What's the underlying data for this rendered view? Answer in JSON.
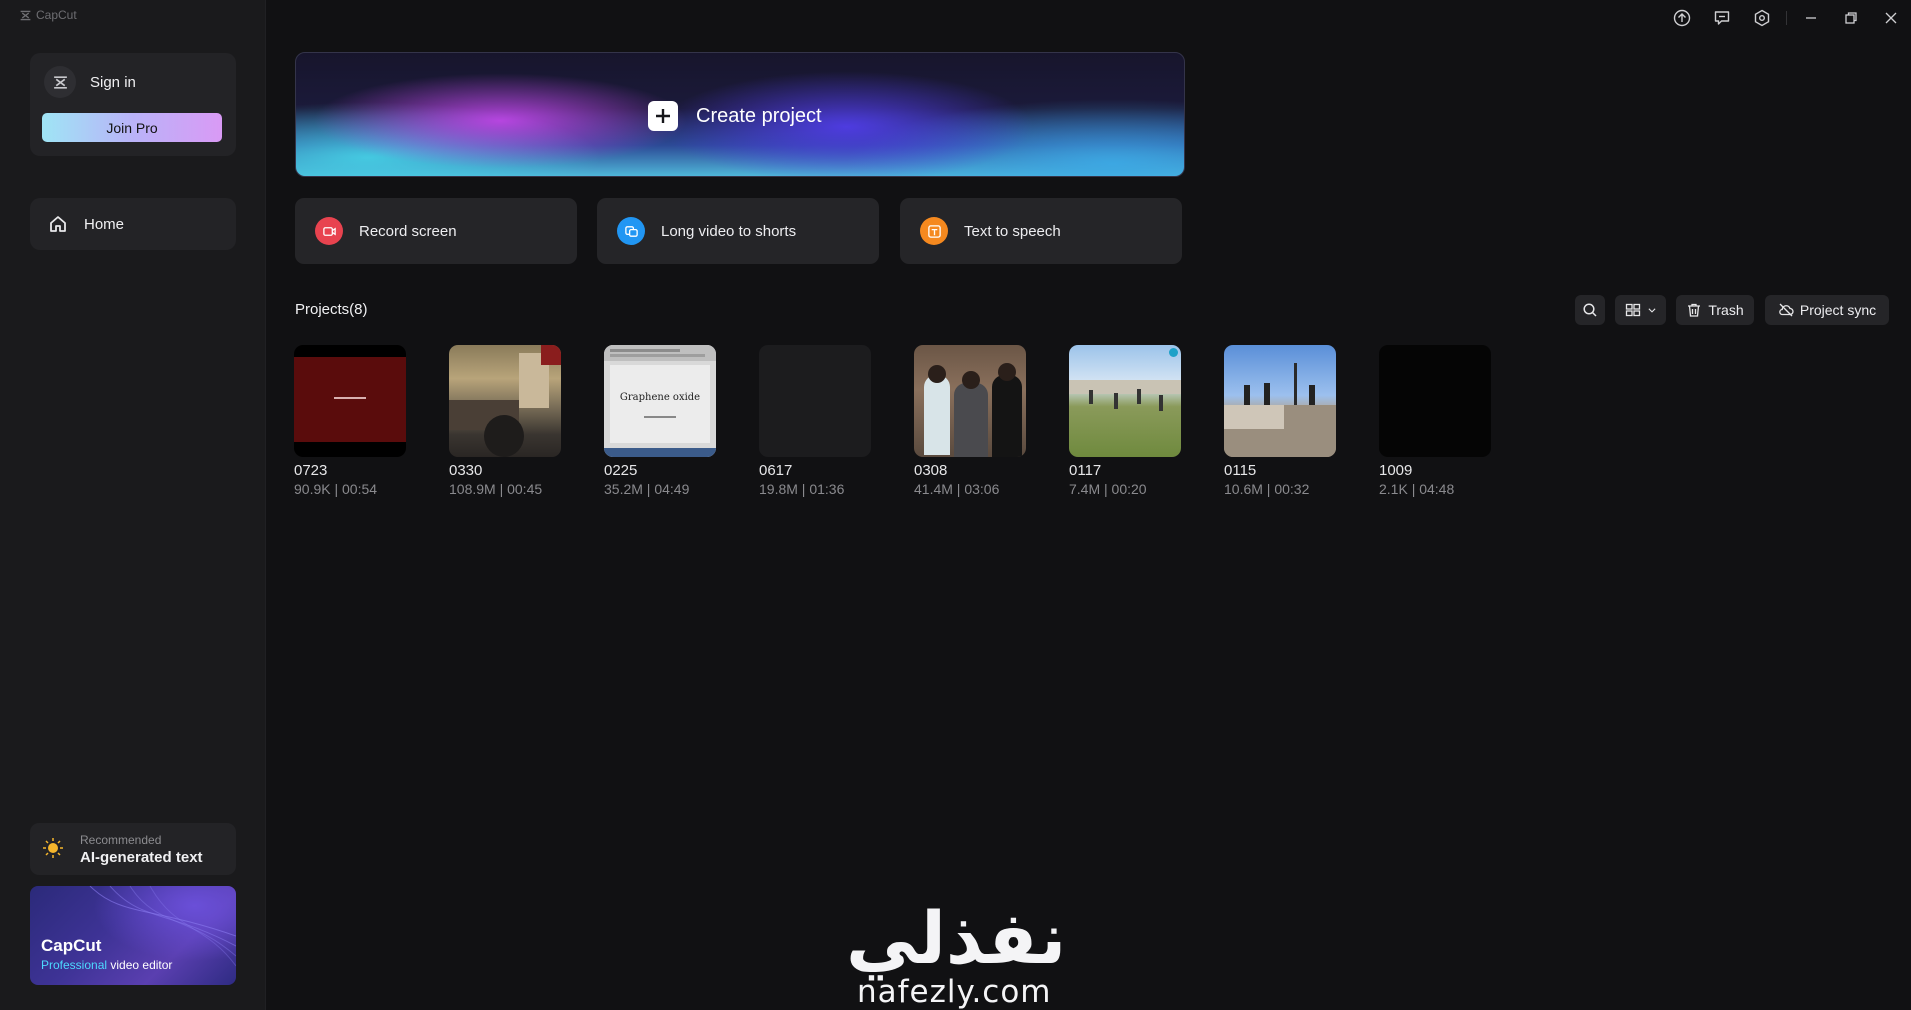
{
  "app": {
    "title": "CapCut"
  },
  "sidebar": {
    "signin_label": "Sign in",
    "join_pro_label": "Join Pro",
    "nav": [
      {
        "label": "Home",
        "icon": "home-icon"
      }
    ],
    "recommended": {
      "caption": "Recommended",
      "title": "AI-generated text",
      "icon": "lightbulb-icon"
    },
    "promo": {
      "title": "CapCut",
      "subtitle_accent": "Professional",
      "subtitle_rest": " video editor"
    }
  },
  "window_controls": [
    "upload-icon",
    "feedback-icon",
    "settings-icon",
    "minimize-icon",
    "restore-icon",
    "close-icon"
  ],
  "main": {
    "create_label": "Create project",
    "quick_actions": [
      {
        "label": "Record screen",
        "icon": "record-screen-icon",
        "color": "#e8434f"
      },
      {
        "label": "Long video to shorts",
        "icon": "long-video-to-shorts-icon",
        "color": "#2196f3"
      },
      {
        "label": "Text to speech",
        "icon": "text-to-speech-icon",
        "color": "#f5891f"
      }
    ],
    "projects_title": "Projects(8)",
    "toolbar": {
      "trash_label": "Trash",
      "sync_label": "Project sync"
    },
    "projects": [
      {
        "name": "0723",
        "meta": "90.9K | 00:54"
      },
      {
        "name": "0330",
        "meta": "108.9M | 00:45"
      },
      {
        "name": "0225",
        "meta": "35.2M | 04:49",
        "thumb_text": "Graphene oxide"
      },
      {
        "name": "0617",
        "meta": "19.8M | 01:36"
      },
      {
        "name": "0308",
        "meta": "41.4M | 03:06"
      },
      {
        "name": "0117",
        "meta": "7.4M | 00:20"
      },
      {
        "name": "0115",
        "meta": "10.6M | 00:32"
      },
      {
        "name": "1009",
        "meta": "2.1K | 04:48"
      }
    ]
  },
  "watermark": {
    "arabic": "نفذلي",
    "latin": "nafezly.com"
  }
}
